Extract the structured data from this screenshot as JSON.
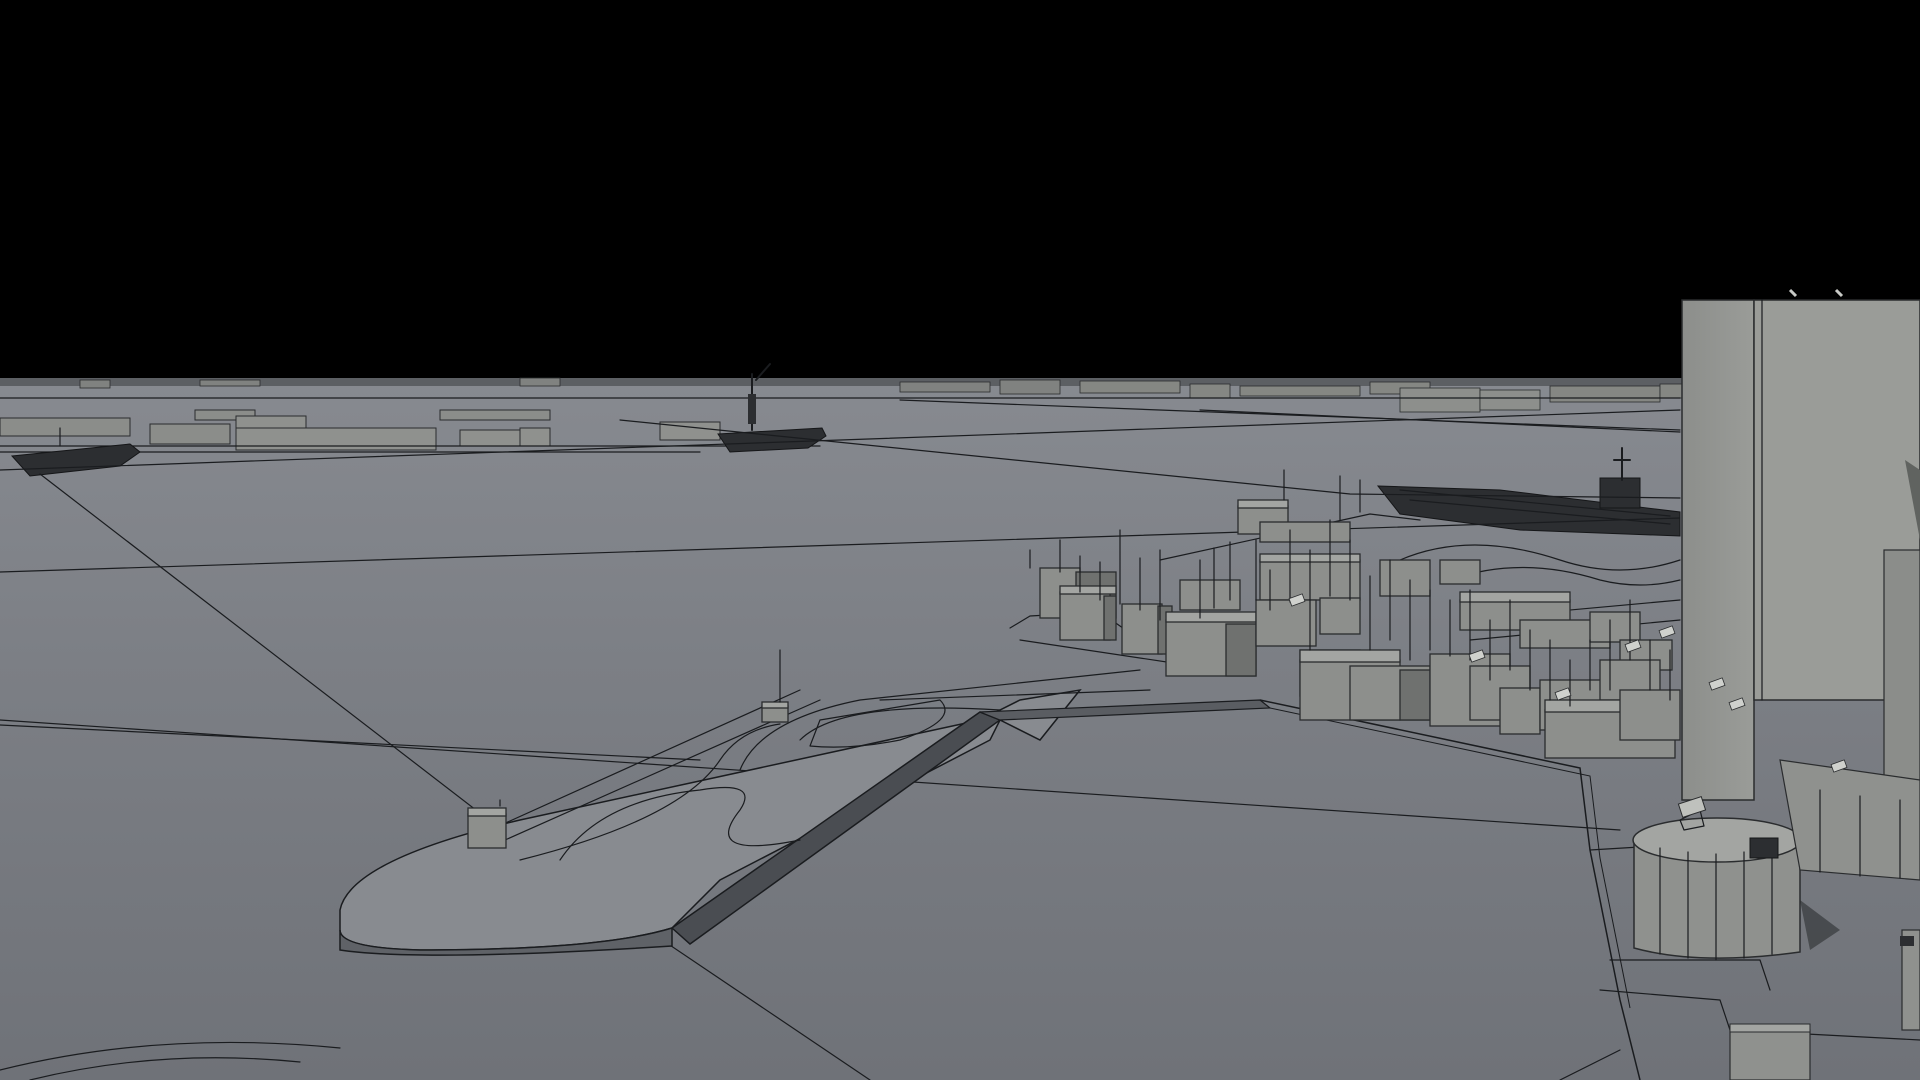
{
  "scene": {
    "kind": "3d-clay-render",
    "subject": "waterfront-city-model-with-aircraft-carriers",
    "sky_color": "#000000",
    "ground_color": "#7d8086",
    "building_color": "#8d8f8c",
    "edge_color": "#1a1c1f"
  }
}
